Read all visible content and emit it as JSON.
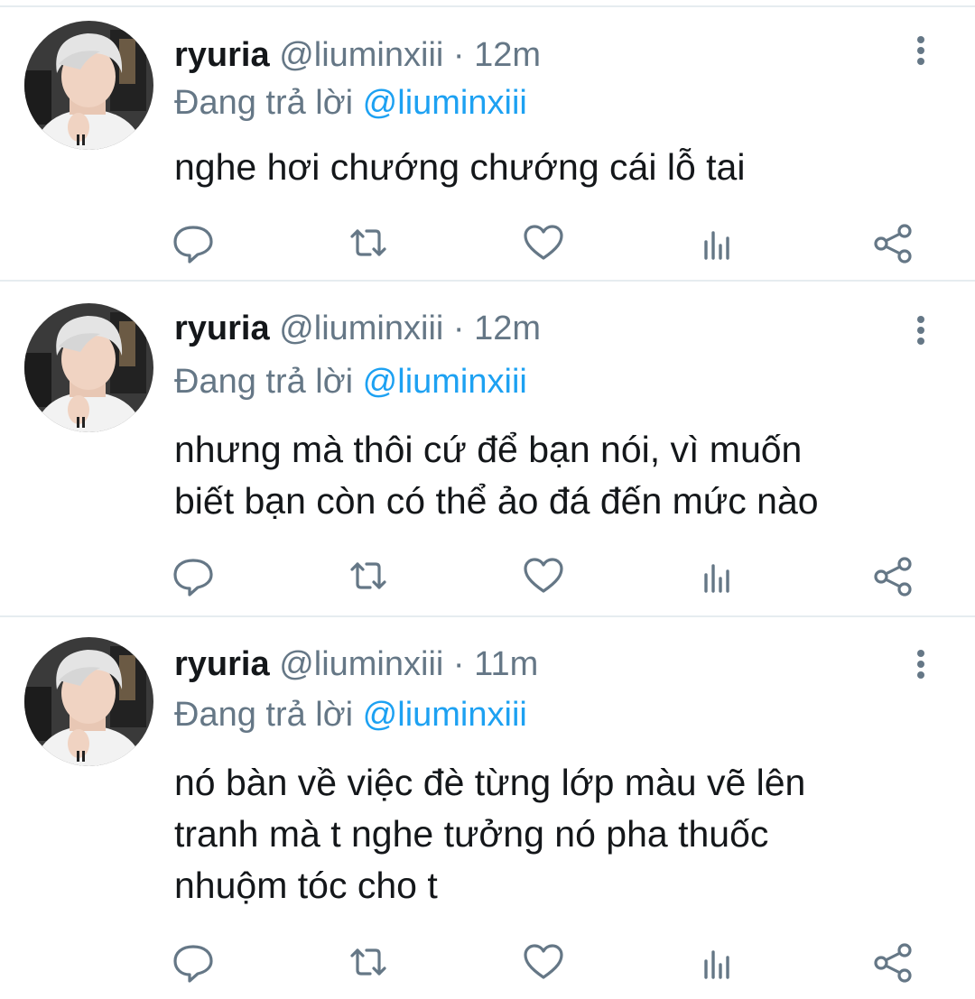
{
  "colors": {
    "primary_text": "#14171a",
    "secondary_text": "#657786",
    "mention": "#1da1f2",
    "divider": "#e6ecf0"
  },
  "icons": [
    "reply-icon",
    "retweet-icon",
    "like-icon",
    "analytics-icon",
    "share-icon",
    "more-options-icon"
  ],
  "tweets": [
    {
      "display_name": "ryuria",
      "handle": "@liuminxiii",
      "separator": "·",
      "time": "12m",
      "replying_prefix": "Đang trả lời",
      "replying_to": "@liuminxiii",
      "lines": [
        "nghe hơi chướng chướng cái lỗ tai"
      ]
    },
    {
      "display_name": "ryuria",
      "handle": "@liuminxiii",
      "separator": "·",
      "time": "12m",
      "replying_prefix": "Đang trả lời",
      "replying_to": "@liuminxiii",
      "lines": [
        "nhưng mà thôi cứ để bạn nói, vì muốn",
        "biết bạn còn có thể ảo đá đến mức nào"
      ]
    },
    {
      "display_name": "ryuria",
      "handle": "@liuminxiii",
      "separator": "·",
      "time": "11m",
      "replying_prefix": "Đang trả lời",
      "replying_to": "@liuminxiii",
      "lines": [
        "nó bàn về việc đè từng lớp màu vẽ lên",
        "tranh mà t nghe tưởng nó pha thuốc",
        "nhuộm tóc cho t"
      ]
    }
  ]
}
